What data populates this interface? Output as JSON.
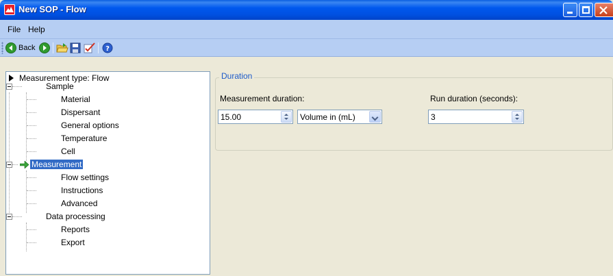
{
  "window": {
    "title": "New SOP - Flow"
  },
  "menu": {
    "file": "File",
    "help": "Help"
  },
  "toolbar": {
    "back_label": "Back"
  },
  "tree": {
    "root": "Measurement type: Flow",
    "sample": "Sample",
    "sample_children": [
      "Material",
      "Dispersant",
      "General options",
      "Temperature",
      "Cell"
    ],
    "measurement": "Measurement",
    "measurement_children": [
      "Flow settings",
      "Instructions",
      "Advanced"
    ],
    "data_processing": "Data processing",
    "data_processing_children": [
      "Reports",
      "Export"
    ]
  },
  "duration": {
    "group_label": "Duration",
    "measurement_duration_label": "Measurement duration:",
    "measurement_duration_value": "15.00",
    "unit_value": "Volume in (mL)",
    "run_duration_label": "Run duration (seconds):",
    "run_duration_value": "3"
  }
}
